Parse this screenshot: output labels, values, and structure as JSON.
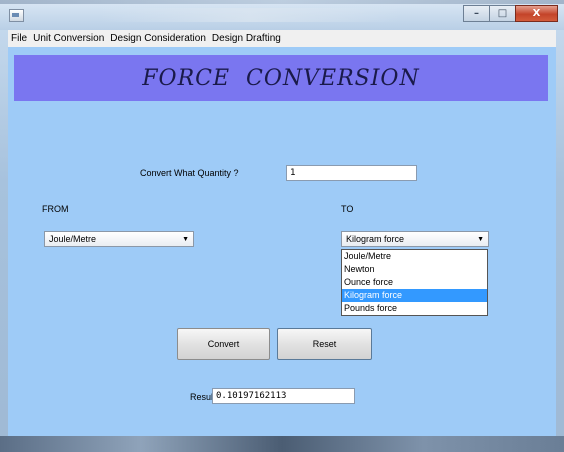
{
  "window": {
    "controls": {
      "minimize": "–",
      "maximize": "□",
      "close": "X"
    }
  },
  "menu": {
    "items": [
      "File",
      "Unit Conversion",
      "Design Consideration",
      "Design Drafting"
    ]
  },
  "banner": {
    "title": "FORCE  CONVERSION"
  },
  "form": {
    "quantity_label": "Convert What Quantity ?",
    "quantity_value": "1",
    "from_label": "FROM",
    "to_label": "TO",
    "from_selected": "Joule/Metre",
    "to_selected": "Kilogram force",
    "to_options": [
      "Joule/Metre",
      "Newton",
      "Ounce force",
      "Kilogram force",
      "Pounds force"
    ],
    "to_options_selected_index": 3,
    "convert_label": "Convert",
    "reset_label": "Reset",
    "result_label": "Result",
    "result_value": "0.10197162113"
  },
  "colors": {
    "content_bg": "#9ecbf7",
    "banner_bg": "#7a76f0",
    "selection": "#3399ff"
  },
  "icons": {
    "app": "app-icon",
    "combo_arrow": "chevron-down-icon"
  }
}
